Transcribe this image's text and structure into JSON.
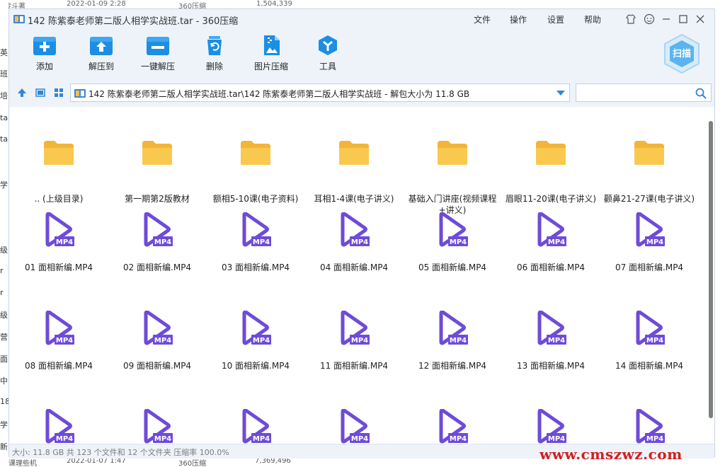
{
  "window": {
    "title": "142 陈紫泰老师第二版人相学实战班.tar - 360压缩",
    "menus": [
      "文件",
      "操作",
      "设置",
      "帮助"
    ]
  },
  "toolbar": {
    "buttons": [
      {
        "label": "添加",
        "icon": "add-icon"
      },
      {
        "label": "解压到",
        "icon": "extract-to-icon"
      },
      {
        "label": "一键解压",
        "icon": "one-click-extract-icon"
      },
      {
        "label": "删除",
        "icon": "delete-icon"
      },
      {
        "label": "图片压缩",
        "icon": "image-compress-icon"
      },
      {
        "label": "工具",
        "icon": "tools-icon"
      }
    ],
    "scan_label": "扫描"
  },
  "path": {
    "text": "142 陈紫泰老师第二版人相学实战班.tar\\142 陈紫泰老师第二版人相学实战班 - 解包大小为 11.8 GB",
    "search_placeholder": ""
  },
  "items": [
    {
      "name": ".. (上级目录)",
      "type": "folder"
    },
    {
      "name": "第一期第2版教材",
      "type": "folder"
    },
    {
      "name": "额相5-10课(电子资料)",
      "type": "folder"
    },
    {
      "name": "耳相1-4课(电子讲义)",
      "type": "folder"
    },
    {
      "name": "基础入门讲座(视频课程+讲义)",
      "type": "folder"
    },
    {
      "name": "眉眼11-20课(电子讲义)",
      "type": "folder"
    },
    {
      "name": "颧鼻21-27课(电子讲义)",
      "type": "folder"
    },
    {
      "name": "01 面相新编.MP4",
      "type": "mp4"
    },
    {
      "name": "02 面相新编.MP4",
      "type": "mp4"
    },
    {
      "name": "03 面相新编.MP4",
      "type": "mp4"
    },
    {
      "name": "04 面相新编.MP4",
      "type": "mp4"
    },
    {
      "name": "05 面相新编.MP4",
      "type": "mp4"
    },
    {
      "name": "06 面相新编.MP4",
      "type": "mp4"
    },
    {
      "name": "07 面相新编.MP4",
      "type": "mp4"
    },
    {
      "name": "08 面相新编.MP4",
      "type": "mp4"
    },
    {
      "name": "09 面相新编.MP4",
      "type": "mp4"
    },
    {
      "name": "10 面相新编.MP4",
      "type": "mp4"
    },
    {
      "name": "11 面相新编.MP4",
      "type": "mp4"
    },
    {
      "name": "12 面相新编.MP4",
      "type": "mp4"
    },
    {
      "name": "13 面相新编.MP4",
      "type": "mp4"
    },
    {
      "name": "14 面相新编.MP4",
      "type": "mp4"
    },
    {
      "name": "",
      "type": "mp4"
    },
    {
      "name": "",
      "type": "mp4"
    },
    {
      "name": "",
      "type": "mp4"
    },
    {
      "name": "",
      "type": "mp4"
    },
    {
      "name": "",
      "type": "mp4"
    },
    {
      "name": "",
      "type": "mp4"
    },
    {
      "name": "",
      "type": "mp4"
    }
  ],
  "mp4_badge": "MP4",
  "status": "大小: 11.8 GB 共 123 个文件和 12 个文件夹 压缩率 100.0%",
  "watermark": "www.cmszwz.com",
  "background": {
    "top_fragments": [
      "传斗著",
      "2022-01-09 2:28",
      "360压缩",
      "1,504,339"
    ],
    "left_fragments": [
      "英",
      "班",
      "培",
      "ta",
      "ta",
      "学",
      "级",
      "r",
      "r",
      "级",
      "营",
      "面",
      "中",
      "18",
      "学",
      "新"
    ],
    "bottom_fragments": [
      "课理些机",
      "2022-01-07 1:47",
      "360压缩",
      "7,369,496"
    ]
  },
  "colors": {
    "folder": "#f9c94f",
    "mp4": "#6e4bd8",
    "accent": "#1c8ee3",
    "watermark": "#d21f1f"
  }
}
